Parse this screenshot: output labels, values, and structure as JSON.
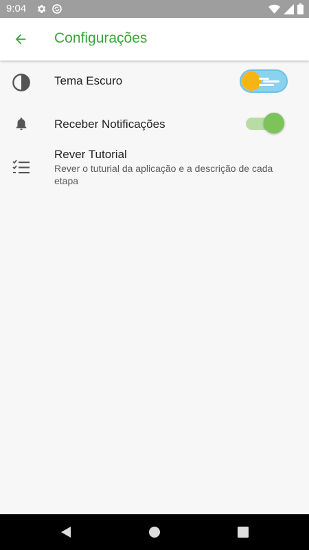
{
  "status_bar": {
    "time": "9:04",
    "icons_left": [
      "gear-icon",
      "sync-icon"
    ],
    "icons_right": [
      "wifi-icon",
      "signal-icon",
      "battery-icon"
    ]
  },
  "app_bar": {
    "title": "Configurações",
    "back_icon": "arrow-back-icon",
    "accent_color": "#3aa53a"
  },
  "settings": {
    "dark_theme": {
      "label": "Tema Escuro",
      "icon": "contrast-icon",
      "enabled": false
    },
    "notifications": {
      "label": "Receber Notificações",
      "icon": "bell-icon",
      "enabled": true
    },
    "tutorial": {
      "label": "Rever Tutorial",
      "description": "Rever o tuturial da aplicação e a descrição de cada etapa",
      "icon": "checklist-icon"
    }
  },
  "nav_bar": {
    "buttons": [
      "back-triangle-icon",
      "home-circle-icon",
      "recents-square-icon"
    ]
  }
}
